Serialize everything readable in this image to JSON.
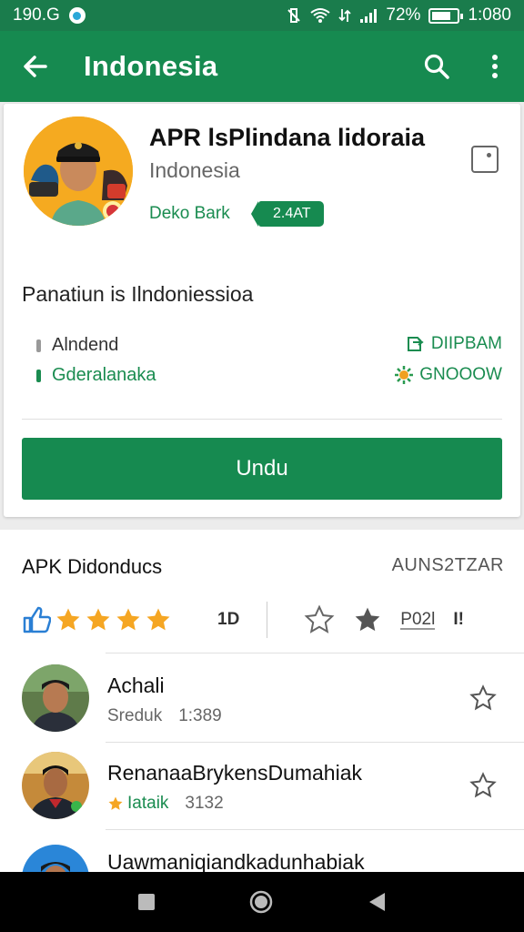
{
  "status_bar": {
    "time_left": "190.G",
    "battery": "72%",
    "time_right": "1:080"
  },
  "app_bar": {
    "title": "Indonesia"
  },
  "app": {
    "title": "APR lsPlindana lidoraia",
    "subtitle": "Indonesia",
    "developer": "Deko Bark",
    "badge": "2.4AT",
    "description": "Panatiun is Ilndoniessioa",
    "info_left": [
      "Alndend",
      "Gderalanaka"
    ],
    "info_right": [
      "DIIPBAM",
      "GNOOOW"
    ],
    "install_label": "Undu"
  },
  "reviews": {
    "section_title": "APK Didonducs",
    "section_right": "AUNS2TZAR",
    "count": "1D",
    "rate_text": "P02l",
    "rate_text2": "I!",
    "items": [
      {
        "name": "Achali",
        "meta1": "Sreduk",
        "meta2": "1:389"
      },
      {
        "name": "RenanaaBrykensDumahiak",
        "meta1": "Iataik",
        "meta2": "3132"
      },
      {
        "name": "Uawmaniqiandkadunhabiak",
        "meta1": "",
        "meta2": ""
      }
    ]
  },
  "colors": {
    "primary": "#168a50",
    "status": "#1a7c4c",
    "star": "#f5a623",
    "like": "#2a7fd4"
  }
}
